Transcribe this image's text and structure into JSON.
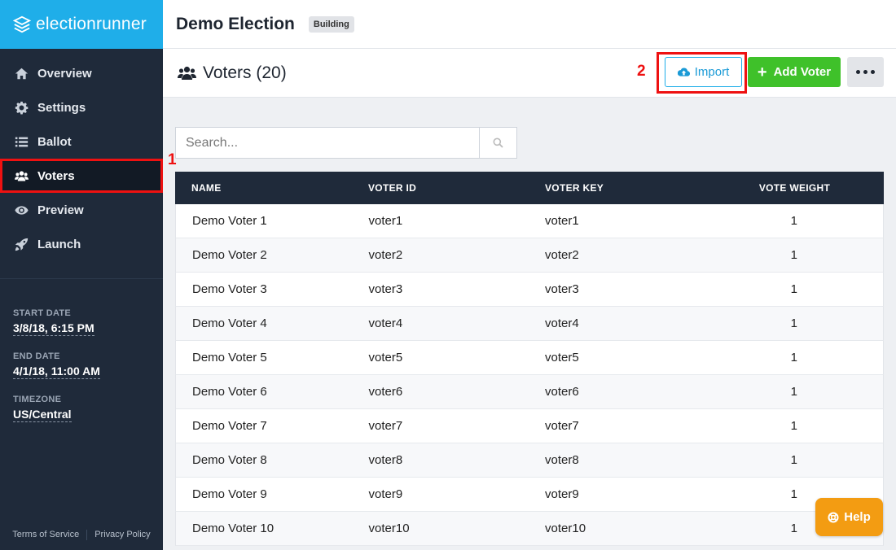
{
  "brand": {
    "logo_text": "electionrunner"
  },
  "sidebar": {
    "items": [
      {
        "label": "Overview",
        "icon": "home-icon"
      },
      {
        "label": "Settings",
        "icon": "gear-icon"
      },
      {
        "label": "Ballot",
        "icon": "list-icon"
      },
      {
        "label": "Voters",
        "icon": "users-icon",
        "active": true
      },
      {
        "label": "Preview",
        "icon": "eye-icon"
      },
      {
        "label": "Launch",
        "icon": "rocket-icon"
      }
    ],
    "start_date_label": "START DATE",
    "start_date_value": "3/8/18, 6:15 PM",
    "end_date_label": "END DATE",
    "end_date_value": "4/1/18, 11:00 AM",
    "timezone_label": "TIMEZONE",
    "timezone_value": "US/Central",
    "footer": {
      "terms": "Terms of Service",
      "privacy": "Privacy Policy"
    }
  },
  "header": {
    "title": "Demo Election",
    "status_badge": "Building"
  },
  "section": {
    "title": "Voters (20)",
    "import_label": "Import",
    "add_label": "Add Voter"
  },
  "annotations": {
    "marker_1": "1",
    "marker_2": "2",
    "highlight_color": "#ee1111"
  },
  "search": {
    "placeholder": "Search..."
  },
  "table": {
    "headers": [
      "NAME",
      "VOTER ID",
      "VOTER KEY",
      "VOTE WEIGHT"
    ],
    "rows": [
      [
        "Demo Voter 1",
        "voter1",
        "voter1",
        "1"
      ],
      [
        "Demo Voter 2",
        "voter2",
        "voter2",
        "1"
      ],
      [
        "Demo Voter 3",
        "voter3",
        "voter3",
        "1"
      ],
      [
        "Demo Voter 4",
        "voter4",
        "voter4",
        "1"
      ],
      [
        "Demo Voter 5",
        "voter5",
        "voter5",
        "1"
      ],
      [
        "Demo Voter 6",
        "voter6",
        "voter6",
        "1"
      ],
      [
        "Demo Voter 7",
        "voter7",
        "voter7",
        "1"
      ],
      [
        "Demo Voter 8",
        "voter8",
        "voter8",
        "1"
      ],
      [
        "Demo Voter 9",
        "voter9",
        "voter9",
        "1"
      ],
      [
        "Demo Voter 10",
        "voter10",
        "voter10",
        "1"
      ]
    ]
  },
  "help": {
    "label": "Help"
  },
  "colors": {
    "brand_blue": "#1faee9",
    "sidebar_bg": "#1f2a3a",
    "add_green": "#3fc12a",
    "help_orange": "#f39c12"
  }
}
